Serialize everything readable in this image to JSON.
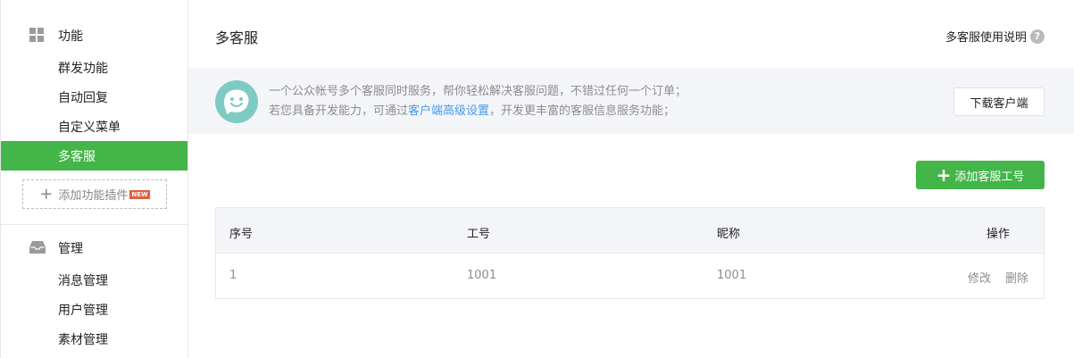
{
  "sidebar": {
    "section1": {
      "title": "功能",
      "icon": "grid-icon"
    },
    "items1": [
      {
        "label": "群发功能"
      },
      {
        "label": "自动回复"
      },
      {
        "label": "自定义菜单"
      },
      {
        "label": "多客服",
        "active": true
      }
    ],
    "add_plugin": {
      "label": "添加功能插件",
      "badge": "NEW"
    },
    "section2": {
      "title": "管理",
      "icon": "tray-icon"
    },
    "items2": [
      {
        "label": "消息管理"
      },
      {
        "label": "用户管理"
      },
      {
        "label": "素材管理"
      }
    ]
  },
  "header": {
    "title": "多客服",
    "help_label": "多客服使用说明",
    "help_icon": "?"
  },
  "info": {
    "line1": "一个公众帐号多个客服同时服务，帮你轻松解决客服问题，不错过任何一个订单；",
    "line2_pre": "若您具备开发能力，可通过",
    "line2_link": "客户端高级设置",
    "line2_post": "，开发更丰富的客服信息服务功能；",
    "download_label": "下载客户端"
  },
  "add_agent": {
    "label": "添加客服工号"
  },
  "table": {
    "headers": {
      "index": "序号",
      "id": "工号",
      "nickname": "昵称",
      "actions": "操作"
    },
    "rows": [
      {
        "index": "1",
        "id": "1001",
        "nickname": "1001",
        "edit": "修改",
        "delete": "删除"
      }
    ]
  },
  "colors": {
    "accent": "#44b549",
    "link": "#459ae9",
    "info_bg": "#f4f5f9"
  }
}
